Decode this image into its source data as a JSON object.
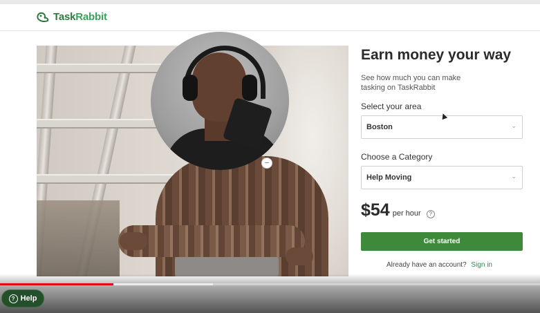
{
  "brand": {
    "name_part1": "Task",
    "name_part2": "Rabbit",
    "logo_color": "#2c7a3f"
  },
  "form": {
    "title": "Earn money your way",
    "subtitle": "See how much you can make tasking on TaskRabbit",
    "area_label": "Select your area",
    "area_value": "Boston",
    "category_label": "Choose a Category",
    "category_value": "Help Moving",
    "price": "$54",
    "price_unit": "per hour",
    "price_help_glyph": "?",
    "cta_label": "Get started",
    "account_prompt": "Already have an account?",
    "signin_label": "Sign in",
    "accent_color": "#3f8a3a"
  },
  "video": {
    "played_fraction": 0.21,
    "buffered_fraction": 0.395,
    "help_label": "Help",
    "help_glyph": "?"
  },
  "icons": {
    "chevron": "chevron-down-icon",
    "logo": "taskrabbit-logo-icon"
  }
}
